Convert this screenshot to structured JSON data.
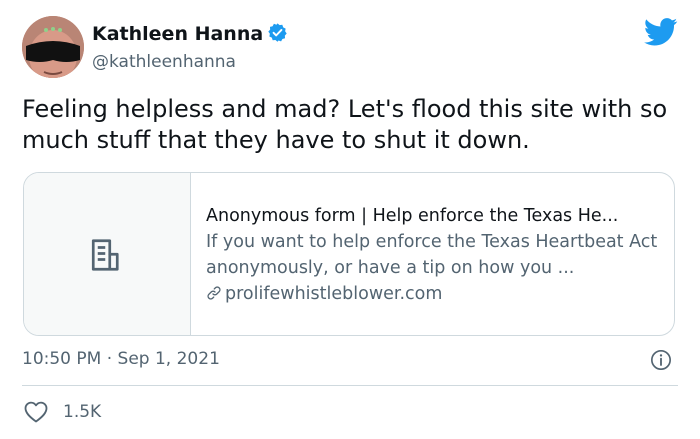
{
  "tweet": {
    "author": {
      "name": "Kathleen Hanna",
      "handle": "@kathleenhanna",
      "verified": true,
      "avatar": "avatar-with-sunglasses"
    },
    "text": "Feeling helpless and mad? Let's flood this site with so much stuff that they have to shut it down.",
    "card": {
      "media_icon": "document-icon",
      "title": "Anonymous form | Help enforce the Texas He...",
      "description": "If you want to help enforce the Texas Heartbeat Act anonymously, or have a tip on how you ...",
      "domain": "prolifewhistleblower.com",
      "link_icon": "link-icon"
    },
    "time": "10:50 PM",
    "separator": "·",
    "date": "Sep 1, 2021",
    "likes": "1.5K"
  },
  "icons": {
    "brand": "twitter-bird-icon",
    "info": "info-icon",
    "like": "heart-icon"
  },
  "colors": {
    "brand": "#1d9bf0",
    "text": "#0f1419",
    "secondary": "#536471",
    "border": "#cfd9de"
  }
}
